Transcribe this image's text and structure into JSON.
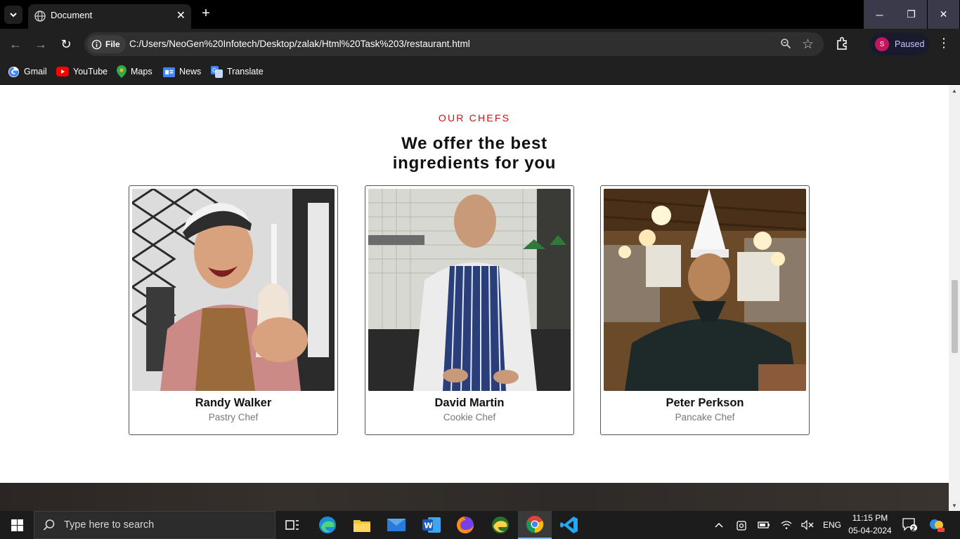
{
  "browser": {
    "tab_title": "Document",
    "url": "C:/Users/NeoGen%20Infotech/Desktop/zalak/Html%20Task%203/restaurant.html",
    "site_chip_label": "File",
    "profile_initial": "S",
    "profile_status": "Paused",
    "bookmarks": [
      {
        "label": "Gmail",
        "icon": "gmail-icon"
      },
      {
        "label": "YouTube",
        "icon": "youtube-icon"
      },
      {
        "label": "Maps",
        "icon": "maps-icon"
      },
      {
        "label": "News",
        "icon": "news-icon"
      },
      {
        "label": "Translate",
        "icon": "translate-icon"
      }
    ]
  },
  "page": {
    "section_label": "OUR CHEFS",
    "heading_line1": "We offer the best",
    "heading_line2": "ingredients for you",
    "chefs": [
      {
        "name": "Randy Walker",
        "role": "Pastry Chef"
      },
      {
        "name": "David Martin",
        "role": "Cookie Chef"
      },
      {
        "name": "Peter Perkson",
        "role": "Pancake Chef"
      }
    ],
    "accent_color": "#ce1212"
  },
  "taskbar": {
    "search_placeholder": "Type here to search",
    "apps": [
      "task-view",
      "edge",
      "file-explorer",
      "mail",
      "word",
      "firefox",
      "edge-dev",
      "chrome",
      "vscode"
    ],
    "language": "ENG",
    "time": "11:15 PM",
    "date": "05-04-2024",
    "notification_count": "2"
  }
}
